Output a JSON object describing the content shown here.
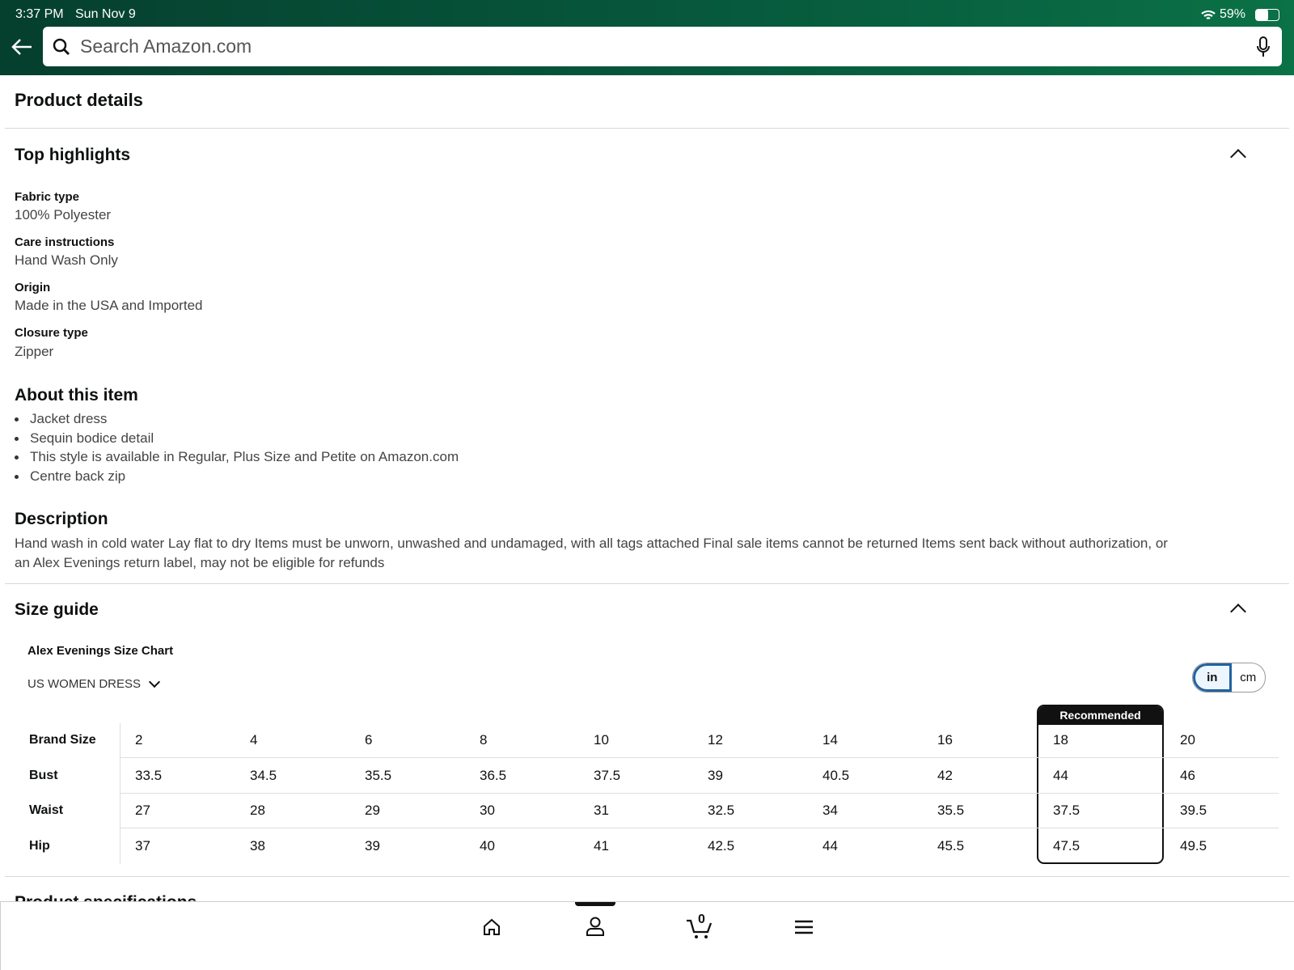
{
  "status_bar": {
    "time": "3:37 PM",
    "date": "Sun Nov 9",
    "battery": "59%"
  },
  "search": {
    "placeholder": "Search Amazon.com"
  },
  "page_title": "Product details",
  "top_highlights": {
    "title": "Top highlights",
    "items": [
      {
        "label": "Fabric type",
        "value": "100% Polyester"
      },
      {
        "label": "Care instructions",
        "value": "Hand Wash Only"
      },
      {
        "label": "Origin",
        "value": "Made in the USA and Imported"
      },
      {
        "label": "Closure type",
        "value": "Zipper"
      }
    ]
  },
  "about": {
    "title": "About this item",
    "bullets": [
      "Jacket dress",
      "Sequin bodice detail",
      "This style is available in Regular, Plus Size and Petite on Amazon.com",
      "Centre back zip"
    ]
  },
  "description": {
    "title": "Description",
    "line1": "Hand wash in cold water Lay flat to dry Items must be unworn, unwashed and undamaged, with all tags attached Final sale items cannot be returned Items sent back without authorization, or",
    "line2": "an Alex Evenings return label, may not be eligible for refunds"
  },
  "size_guide": {
    "title": "Size guide",
    "chart_title": "Alex Evenings Size Chart",
    "region": "US WOMEN DRESS",
    "units": [
      "in",
      "cm"
    ],
    "selected_unit": "in",
    "recommended_label": "Recommended",
    "recommended_size": "18",
    "rows": [
      {
        "label": "Brand Size",
        "values": [
          "2",
          "4",
          "6",
          "8",
          "10",
          "12",
          "14",
          "16",
          "18",
          "20"
        ]
      },
      {
        "label": "Bust",
        "values": [
          "33.5",
          "34.5",
          "35.5",
          "36.5",
          "37.5",
          "39",
          "40.5",
          "42",
          "44",
          "46"
        ]
      },
      {
        "label": "Waist",
        "values": [
          "27",
          "28",
          "29",
          "30",
          "31",
          "32.5",
          "34",
          "35.5",
          "37.5",
          "39.5"
        ]
      },
      {
        "label": "Hip",
        "values": [
          "37",
          "38",
          "39",
          "40",
          "41",
          "42.5",
          "44",
          "45.5",
          "47.5",
          "49.5"
        ]
      }
    ]
  },
  "next_section": "Product specifications",
  "bottom_nav": {
    "cart_count": "0",
    "items": [
      "home-icon",
      "account-icon",
      "cart-icon",
      "menu-icon"
    ]
  },
  "colors": {
    "header": "#065a3d",
    "toggle_accent": "#2162a1"
  }
}
